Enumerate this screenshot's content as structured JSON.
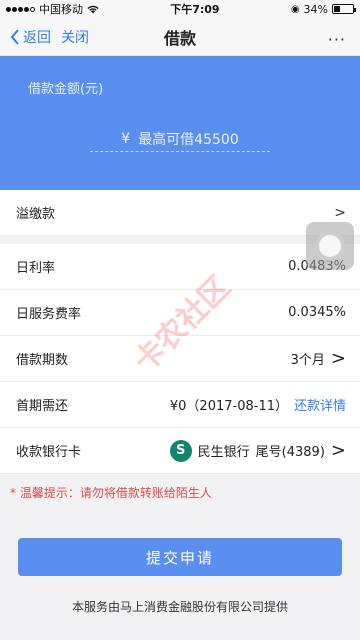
{
  "status_bar": {
    "carrier": "中国移动",
    "time": "下午7:09",
    "battery": "34%",
    "battery_fraction": 0.34
  },
  "nav": {
    "back_label": "返回",
    "close_label": "关闭",
    "title": "借款",
    "more_label": "···"
  },
  "hero": {
    "label": "借款金额(元)",
    "currency": "¥",
    "placeholder": "最高可借45500"
  },
  "rows": {
    "overpay": {
      "label": "溢缴款",
      "arrow": ">"
    },
    "daily_rate": {
      "label": "日利率",
      "value": "0.0483%"
    },
    "daily_service": {
      "label": "日服务费率",
      "value": "0.0345%"
    },
    "term": {
      "label": "借款期数",
      "value": "3个月",
      "arrow": ">"
    },
    "first_payment": {
      "label": "首期需还",
      "value": "¥0（2017-08-11）",
      "link": "还款详情"
    },
    "bank_card": {
      "label": "收款银行卡",
      "bank": "民生银行",
      "tail": "尾号(4389)",
      "arrow": ">"
    }
  },
  "tip": "* 温馨提示：请勿将借款转账给陌生人",
  "submit_label": "提交申请",
  "footer": "本服务由马上消费金融股份有限公司提供",
  "watermark": "卡农社区",
  "colors": {
    "accent": "#5a8ff0",
    "link": "#2e7cf6",
    "warning": "#e04a4a",
    "bank": "#11866d"
  }
}
